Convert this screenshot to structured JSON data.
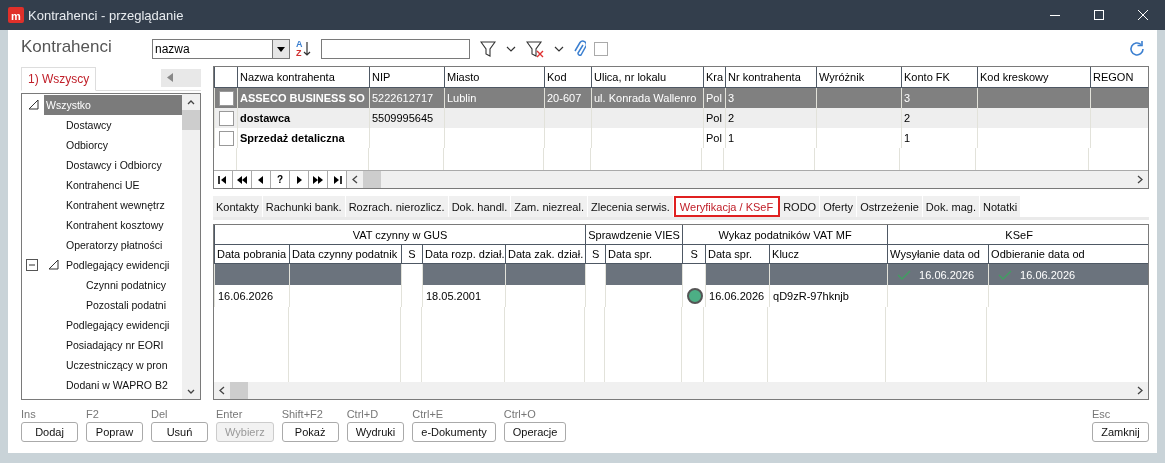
{
  "window": {
    "title": "Kontrahenci - przeglądanie",
    "logo_text": "m"
  },
  "toolbar": {
    "heading": "Kontrahenci",
    "sort_field": {
      "value": "nazwa"
    },
    "sort_button": {
      "top": "A",
      "bottom": "Z"
    },
    "attachment_checkbox": {
      "checked": false
    }
  },
  "side_tabs": [
    {
      "label": "1) Wszyscy",
      "selected": true
    }
  ],
  "tree": [
    {
      "label": "Wszystko",
      "selected": true,
      "expanded": true,
      "children": [
        {
          "label": "Dostawcy",
          "selected": false
        },
        {
          "label": "Odbiorcy",
          "selected": false
        },
        {
          "label": "Dostawcy i Odbiorcy",
          "selected": false
        },
        {
          "label": "Kontrahenci UE",
          "selected": false
        },
        {
          "label": "Kontrahent wewnętrz",
          "selected": false
        },
        {
          "label": "Kontrahent kosztowy",
          "selected": false
        },
        {
          "label": "Operatorzy płatności",
          "selected": false
        },
        {
          "label": "Podlegający ewidencji",
          "selected": false,
          "expanded": true,
          "children": [
            {
              "label": "Czynni podatnicy",
              "selected": false
            },
            {
              "label": "Pozostali podatni",
              "selected": false
            }
          ]
        },
        {
          "label": "Podlegający ewidencji",
          "selected": false
        },
        {
          "label": "Posiadający nr EORI",
          "selected": false
        },
        {
          "label": "Uczestniczący w pron",
          "selected": false
        },
        {
          "label": "Dodani w WAPRO B2",
          "selected": false
        }
      ]
    }
  ],
  "contractors": {
    "columns": [
      "Nazwa kontrahenta",
      "NIP",
      "Miasto",
      "Kod",
      "Ulica, nr lokalu",
      "Kra",
      "Nr kontrahenta",
      "Wyróżnik",
      "Konto FK",
      "Kod kreskowy",
      "REGON"
    ],
    "rows": [
      {
        "selected": true,
        "checked": false,
        "cells": [
          "ASSECO BUSINESS SO",
          "5222612717",
          "Lublin",
          "20-607",
          "ul. Konrada Wallenro",
          "Pol",
          "3",
          null,
          "3",
          null,
          null
        ]
      },
      {
        "selected": false,
        "checked": false,
        "cells": [
          "dostawca",
          "5509995645",
          null,
          null,
          null,
          "Pol",
          "2",
          null,
          "2",
          null,
          null
        ]
      },
      {
        "selected": false,
        "checked": false,
        "cells": [
          "Sprzedaż detaliczna",
          null,
          null,
          null,
          null,
          "Pol",
          "1",
          null,
          "1",
          null,
          null
        ]
      }
    ],
    "navigator": [
      {
        "kind": "first"
      },
      {
        "kind": "prev-page"
      },
      {
        "kind": "prev"
      },
      {
        "kind": "query",
        "label": "?"
      },
      {
        "kind": "next"
      },
      {
        "kind": "next-page"
      },
      {
        "kind": "last"
      }
    ]
  },
  "detail_tabs": [
    {
      "label": "Kontakty",
      "selected": false
    },
    {
      "label": "Rachunki bank.",
      "selected": false
    },
    {
      "label": "Rozrach. nierozlicz.",
      "selected": false
    },
    {
      "label": "Dok. handl.",
      "selected": false
    },
    {
      "label": "Zam. niezreal.",
      "selected": false
    },
    {
      "label": "Zlecenia serwis.",
      "selected": false
    },
    {
      "label": "Weryfikacja / KSeF",
      "selected": true
    },
    {
      "label": "RODO",
      "selected": false
    },
    {
      "label": "Oferty",
      "selected": false
    },
    {
      "label": "Ostrzeżenie",
      "selected": false
    },
    {
      "label": "Dok. mag.",
      "selected": false
    },
    {
      "label": "Notatki",
      "selected": false
    }
  ],
  "verification": {
    "groups": [
      {
        "label": "VAT czynny w GUS",
        "columns": [
          "Data pobrania",
          "Data czynny podatnik",
          "S",
          "Data rozp. dział.",
          "Data zak. dział."
        ]
      },
      {
        "label": "Sprawdzenie VIES",
        "columns": [
          "S",
          "Data spr."
        ]
      },
      {
        "label": "Wykaz podatników VAT MF",
        "columns": [
          "S",
          "Data spr.",
          "Klucz"
        ]
      },
      {
        "label": "KSeF",
        "columns": [
          "Wysyłanie data od",
          "Odbieranie data od"
        ]
      }
    ],
    "filter_row": [
      {
        "kind": "filter"
      },
      {
        "kind": "filter"
      },
      {
        "kind": "plain"
      },
      {
        "kind": "filter"
      },
      {
        "kind": "filter"
      },
      {
        "kind": "plain"
      },
      {
        "kind": "filter"
      },
      {
        "kind": "plain"
      },
      {
        "kind": "filter"
      },
      {
        "kind": "filter"
      },
      {
        "kind": "filter",
        "text": "16.06.2026",
        "checked": true
      },
      {
        "kind": "filter",
        "text": "16.06.2026",
        "checked": true
      }
    ],
    "rows": [
      [
        "16.06.2026",
        null,
        null,
        "18.05.2001",
        null,
        null,
        null,
        {
          "kind": "status",
          "color": "#4caf85"
        },
        "16.06.2026",
        "qD9zR-97hknjb",
        null,
        null
      ]
    ]
  },
  "actions": [
    {
      "shortcut": "Ins",
      "label": "Dodaj",
      "disabled": false
    },
    {
      "shortcut": "F2",
      "label": "Popraw",
      "disabled": false
    },
    {
      "shortcut": "Del",
      "label": "Usuń",
      "disabled": false
    },
    {
      "shortcut": "Enter",
      "label": "Wybierz",
      "disabled": true
    },
    {
      "shortcut": "Shift+F2",
      "label": "Pokaż",
      "disabled": false
    },
    {
      "shortcut": "Ctrl+D",
      "label": "Wydruki",
      "disabled": false
    },
    {
      "shortcut": "Ctrl+E",
      "label": "e-Dokumenty",
      "disabled": false
    },
    {
      "shortcut": "Ctrl+O",
      "label": "Operacje",
      "disabled": false
    }
  ],
  "close_action": {
    "shortcut": "Esc",
    "label": "Zamknij",
    "disabled": false
  }
}
